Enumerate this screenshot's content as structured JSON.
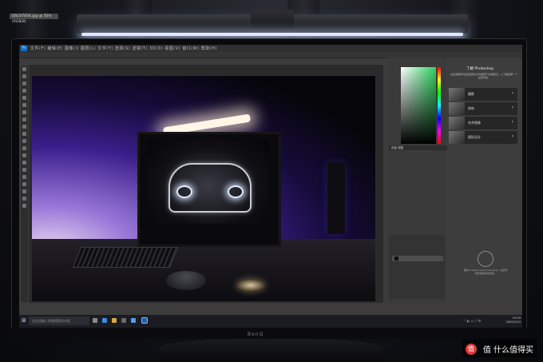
{
  "photoshop": {
    "menu_bar": "文件(F) 编辑(E) 图像(I) 图层(L) 文字(Y) 选择(S) 滤镜(T) 3D(D) 视图(V) 窗口(W) 帮助(H)",
    "doc_tab": "DSC07834.jpg @ 50%(RGB/8)",
    "panel_tabs": "色板   调整",
    "learn_title": "了解 Photoshop",
    "learn_desc": "在应用程序内直接使用分步指南学习基础知识。从下面选择一个主题开始。",
    "learn_cards": [
      "摄影",
      "修饰",
      "合并图像",
      "图形设计"
    ],
    "creative_cloud": "借助 Creative Cloud Libraries，在任何位置使用您的资源。"
  },
  "taskbar": {
    "search_placeholder": "在这里输入你要搜索的内容",
    "time": "15:33",
    "date": "2020/1/13"
  },
  "monitor_brand": "BenQ",
  "watermark": "值 什么值得买",
  "colors": {
    "photoshop_blue": "#0d6fc9",
    "light_glow": "#dfe8ff",
    "purple_glow": "#3b1f8c",
    "watermark_red": "#e4393c"
  }
}
